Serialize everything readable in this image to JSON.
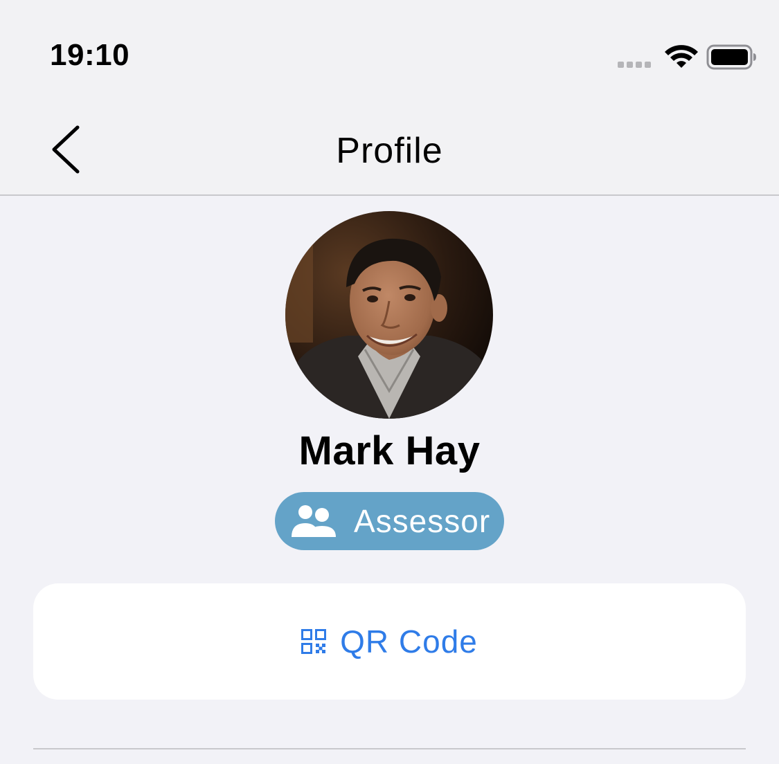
{
  "status_bar": {
    "time": "19:10",
    "icons": [
      "signal-dots-icon",
      "wifi-icon",
      "battery-icon"
    ]
  },
  "nav": {
    "title": "Profile",
    "back_icon": "chevron-left-icon"
  },
  "profile": {
    "name": "Mark Hay",
    "role": "Assessor",
    "role_icon": "people-icon"
  },
  "qr_button": {
    "label": "QR Code",
    "icon": "qr-code-icon"
  },
  "colors": {
    "background": "#f2f2f7",
    "badge": "#64a3c8",
    "link": "#2f7ce8",
    "card": "#ffffff"
  }
}
